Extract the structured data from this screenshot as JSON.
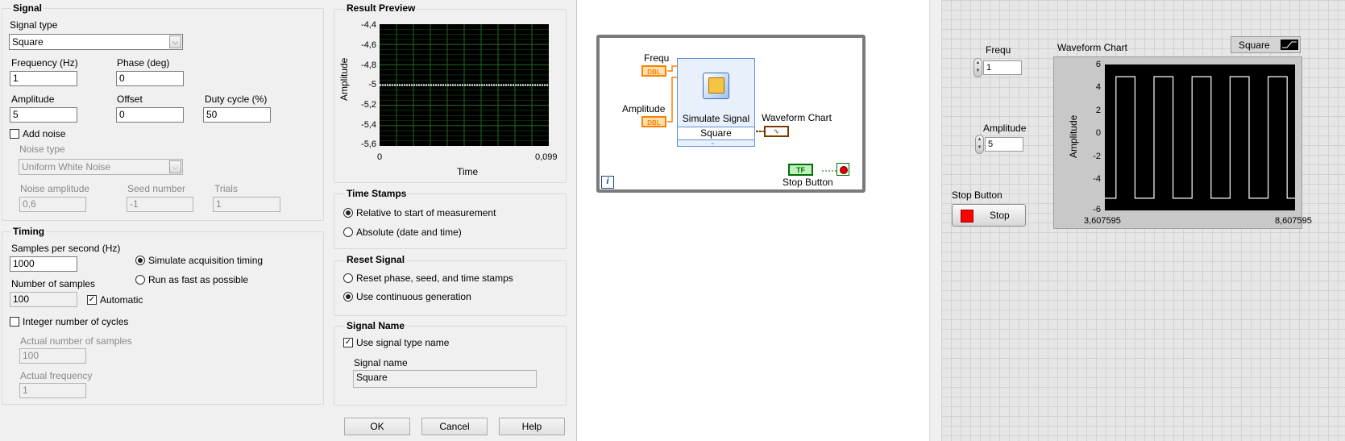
{
  "dialog": {
    "signal": {
      "title": "Signal",
      "type_label": "Signal type",
      "type_value": "Square",
      "freq_label": "Frequency (Hz)",
      "freq_value": "1",
      "phase_label": "Phase (deg)",
      "phase_value": "0",
      "amp_label": "Amplitude",
      "amp_value": "5",
      "offset_label": "Offset",
      "offset_value": "0",
      "duty_label": "Duty cycle (%)",
      "duty_value": "50",
      "add_noise_label": "Add noise",
      "noise_type_label": "Noise type",
      "noise_type_value": "Uniform White Noise",
      "noise_amp_label": "Noise amplitude",
      "noise_amp_value": "0,6",
      "seed_label": "Seed number",
      "seed_value": "-1",
      "trials_label": "Trials",
      "trials_value": "1"
    },
    "timing": {
      "title": "Timing",
      "sps_label": "Samples per second (Hz)",
      "sps_value": "1000",
      "sim_acq_label": "Simulate acquisition timing",
      "run_fast_label": "Run as fast as possible",
      "nsamples_label": "Number of samples",
      "nsamples_value": "100",
      "automatic_label": "Automatic",
      "int_cycles_label": "Integer number of cycles",
      "actual_n_label": "Actual number of samples",
      "actual_n_value": "100",
      "actual_freq_label": "Actual frequency",
      "actual_freq_value": "1"
    },
    "preview": {
      "title": "Result Preview",
      "ylabel": "Amplitude",
      "xlabel": "Time",
      "yticks": [
        "-4,4",
        "-4,6",
        "-4,8",
        "-5",
        "-5,2",
        "-5,4",
        "-5,6"
      ],
      "xticks": [
        "0",
        "0,099"
      ]
    },
    "timestamps": {
      "title": "Time Stamps",
      "relative_label": "Relative to start of measurement",
      "absolute_label": "Absolute (date and time)"
    },
    "reset": {
      "title": "Reset Signal",
      "reset_label": "Reset phase, seed, and time stamps",
      "continuous_label": "Use continuous generation"
    },
    "signame": {
      "title": "Signal Name",
      "use_type_label": "Use signal type name",
      "name_label": "Signal name",
      "name_value": "Square"
    },
    "buttons": {
      "ok": "OK",
      "cancel": "Cancel",
      "help": "Help"
    }
  },
  "diagram": {
    "freq_label": "Frequ",
    "amp_label": "Amplitude",
    "dbl": "DBL",
    "vi_title": "Simulate Signal",
    "vi_mode": "Square",
    "chart_label": "Waveform Chart",
    "tf": "TF",
    "stop_label": "Stop Button",
    "loop_i": "i"
  },
  "panel": {
    "freq_label": "Frequ",
    "freq_value": "1",
    "amp_label": "Amplitude",
    "amp_value": "5",
    "stop_label": "Stop Button",
    "stop_button": "Stop",
    "chart_title": "Waveform Chart",
    "legend_label": "Square",
    "ylabel": "Amplitude",
    "yticks": [
      "6",
      "4",
      "2",
      "0",
      "-2",
      "-4",
      "-6"
    ],
    "xticks": [
      "3,607595",
      "8,607595"
    ]
  },
  "chart_data": [
    {
      "type": "line",
      "title": "Result Preview",
      "xlabel": "Time",
      "ylabel": "Amplitude",
      "xlim": [
        0,
        0.099
      ],
      "ylim": [
        -5.6,
        -4.4
      ],
      "grid": true,
      "series": [
        {
          "x": [
            0,
            0.099
          ],
          "values": [
            -5,
            -5
          ]
        }
      ]
    },
    {
      "type": "line",
      "title": "Waveform Chart",
      "ylabel": "Amplitude",
      "xlim": [
        3.607595,
        8.607595
      ],
      "ylim": [
        -6,
        6
      ],
      "legend": "top-right",
      "series": [
        {
          "name": "Square",
          "x": [
            3.607595,
            3.9,
            3.9,
            4.4,
            4.4,
            4.9,
            4.9,
            5.4,
            5.4,
            5.9,
            5.9,
            6.4,
            6.4,
            6.9,
            6.9,
            7.4,
            7.4,
            7.9,
            7.9,
            8.4,
            8.4,
            8.607595
          ],
          "values": [
            -5,
            -5,
            5,
            5,
            -5,
            -5,
            5,
            5,
            -5,
            -5,
            5,
            5,
            -5,
            -5,
            5,
            5,
            -5,
            -5,
            5,
            5,
            -5,
            -5
          ]
        }
      ]
    }
  ],
  "colors": {
    "dialog_bg": "#f0f0f0",
    "preview_plot_bg": "#000000",
    "preview_grid": "#1f6b1f",
    "chart_trace": "#ffffff",
    "wire_numeric": "#ff8000",
    "wire_boolean": "#007000",
    "stop_led": "#ff0000"
  }
}
